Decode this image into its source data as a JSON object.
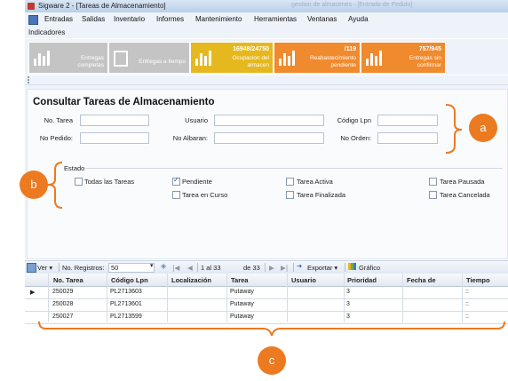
{
  "window": {
    "title": "Sigware 2 - [Tareas de Almacenamiento]",
    "ghost_text": "gestion de almacenes - [Entrada de Pedido]"
  },
  "menu": {
    "items": [
      "Entradas",
      "Salidas",
      "Inventario",
      "Informes",
      "Mantenimiento",
      "Herramientas",
      "Ventanas",
      "Ayuda"
    ]
  },
  "indicadores": {
    "label": "Indicadores",
    "tiles": [
      {
        "value": "",
        "caption": "Entregas completas",
        "color": "#c4c4c4",
        "icon": "bar-chart-icon"
      },
      {
        "value": "",
        "caption": "Entregas a tiempo",
        "color": "#c4c4c4",
        "icon": "checklist-icon"
      },
      {
        "value": "16948/24750",
        "caption": "Ocupacion del almacen",
        "color": "#e6b820",
        "icon": "bar-chart-icon"
      },
      {
        "value": "/119",
        "caption": "Reabastecimiento pendiente",
        "color": "#f08a2e",
        "icon": "bar-chart-icon"
      },
      {
        "value": "757/945",
        "caption": "Entregas sin confirmar",
        "color": "#f08a2e",
        "icon": "bar-chart-icon"
      }
    ]
  },
  "form": {
    "title": "Consultar Tareas de Almacenamiento",
    "labels": {
      "no_tarea": "No. Tarea",
      "usuario": "Usuario",
      "codigo_lpn": "Código Lpn",
      "no_pedido": "No Pedido:",
      "no_albaran": "No Albaran:",
      "no_orden": "No Orden:"
    },
    "estado": {
      "label": "Estado",
      "options": [
        {
          "label": "Todas las Tareas",
          "checked": false
        },
        {
          "label": "Pendiente",
          "checked": true
        },
        {
          "label": "Tarea Activa",
          "checked": false
        },
        {
          "label": "Tarea Pausada",
          "checked": false
        },
        {
          "label": "Tarea en Curso",
          "checked": false
        },
        {
          "label": "Tarea Finalizada",
          "checked": false
        },
        {
          "label": "Tarea Cancelada",
          "checked": false
        }
      ]
    }
  },
  "toolbar": {
    "ver": "Ver ▾",
    "no_registros_label": "No. Registros:",
    "no_registros_value": "50",
    "page_current": "1 al 33",
    "page_total": "de 33",
    "exportar": "Exportar ▾",
    "grafico": "Gráfico"
  },
  "grid": {
    "columns": [
      "No. Tarea",
      "Código Lpn",
      "Localización",
      "Tarea",
      "Usuario",
      "Prioridad",
      "Fecha de",
      "Tiempo"
    ],
    "rows": [
      [
        "250029",
        "PL2713603",
        "",
        "Putaway",
        "",
        "3",
        "",
        "::"
      ],
      [
        "250028",
        "PL2713601",
        "",
        "Putaway",
        "",
        "3",
        "",
        "::"
      ],
      [
        "250027",
        "PL2713599",
        "",
        "Putaway",
        "",
        "3",
        "",
        "::"
      ]
    ]
  },
  "annotations": {
    "a": "a",
    "b": "b",
    "c": "c"
  },
  "colors": {
    "accent_orange": "#ec7a21",
    "tile_gray": "#c4c4c4",
    "tile_yellow": "#e6b820",
    "tile_orange": "#f08a2e"
  }
}
